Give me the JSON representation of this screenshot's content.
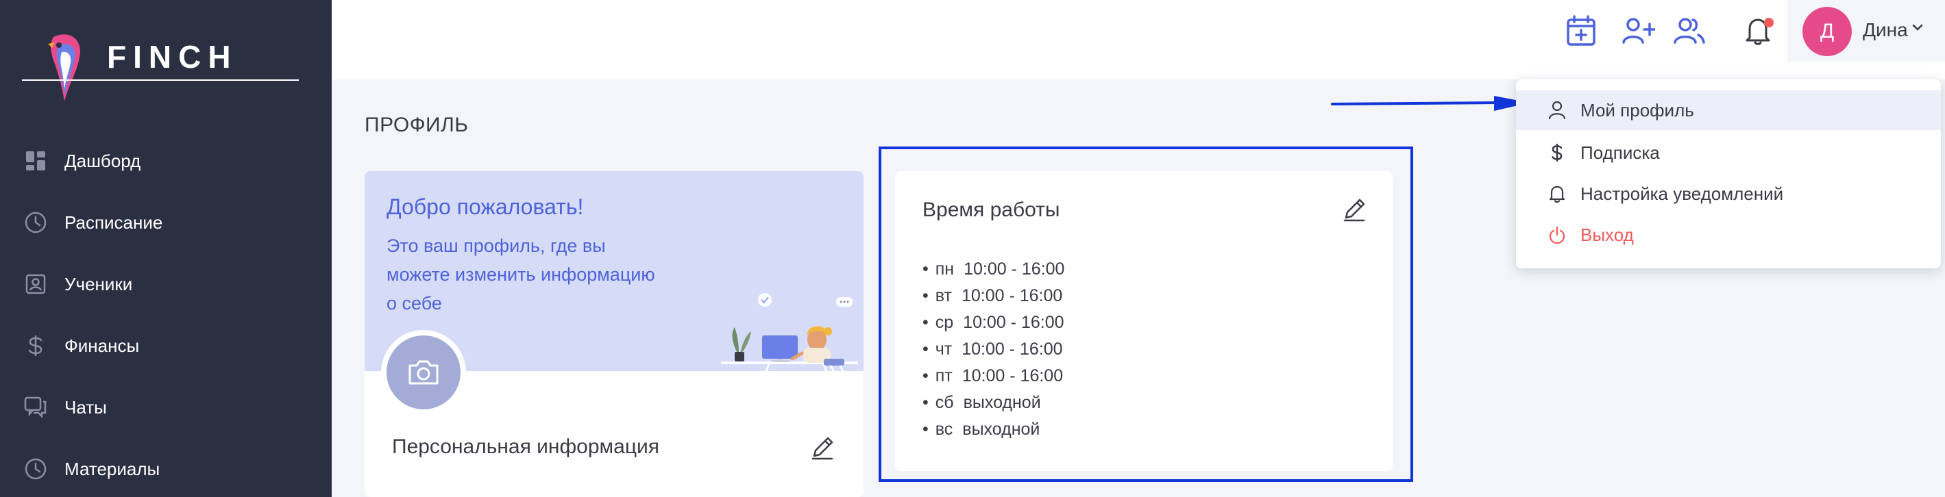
{
  "app": {
    "logo_text": "FINCH"
  },
  "sidebar": {
    "items": [
      {
        "label": "Дашборд",
        "icon": "dashboard-icon"
      },
      {
        "label": "Расписание",
        "icon": "clock-icon"
      },
      {
        "label": "Ученики",
        "icon": "student-icon"
      },
      {
        "label": "Финансы",
        "icon": "dollar-icon"
      },
      {
        "label": "Чаты",
        "icon": "chat-icon"
      },
      {
        "label": "Материалы",
        "icon": "clock-icon"
      }
    ]
  },
  "topbar": {
    "user_initial": "Д",
    "user_name": "Дина",
    "icons": [
      "calendar-plus-icon",
      "add-user-icon",
      "users-icon",
      "bell-icon"
    ],
    "accent_color": "#4e63d9",
    "notification_dot_color": "#f25a5a"
  },
  "page": {
    "title": "ПРОФИЛЬ"
  },
  "welcome": {
    "title": "Добро пожаловать!",
    "text": "Это ваш профиль, где вы можете изменить информацию о себе"
  },
  "personal": {
    "title": "Персональная информация"
  },
  "work_hours": {
    "title": "Время работы",
    "bullet": "•",
    "days": [
      {
        "day": "пн",
        "hours": "10:00 - 16:00"
      },
      {
        "day": "вт",
        "hours": "10:00 - 16:00"
      },
      {
        "day": "ср",
        "hours": "10:00 - 16:00"
      },
      {
        "day": "чт",
        "hours": "10:00 - 16:00"
      },
      {
        "day": "пт",
        "hours": "10:00 - 16:00"
      },
      {
        "day": "сб",
        "hours": "выходной"
      },
      {
        "day": "вс",
        "hours": "выходной"
      }
    ]
  },
  "dropdown": {
    "items": [
      {
        "label": "Мой профиль",
        "icon": "user-icon"
      },
      {
        "label": "Подписка",
        "icon": "dollar-icon"
      },
      {
        "label": "Настройка уведомлений",
        "icon": "bell-icon"
      },
      {
        "label": "Выход",
        "icon": "power-icon"
      }
    ]
  },
  "colors": {
    "highlight_box": "#1234d8",
    "logout_text": "#f25a5a",
    "sidebar_bg": "#2b2f42"
  }
}
